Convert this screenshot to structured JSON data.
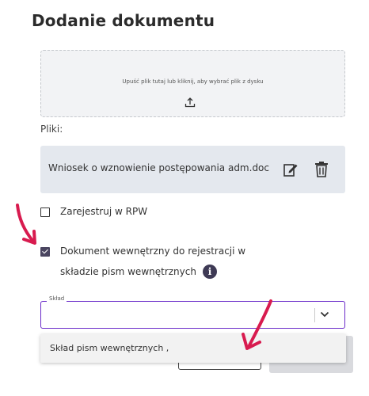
{
  "dialog": {
    "title": "Dodanie dokumentu"
  },
  "upload": {
    "dropzone_text": "Upuść plik tutaj lub kliknij, aby wybrać plik z dysku",
    "icon": "upload-icon"
  },
  "files": {
    "label": "Pliki:",
    "items": [
      {
        "name": "Wniosek o wznowienie postępowania adm.doc"
      }
    ]
  },
  "options": {
    "register_rpw": {
      "label": "Zarejestruj w RPW",
      "checked": false
    },
    "internal_doc": {
      "label_line1": "Dokument wewnętrzny do rejestracji w",
      "label_line2": "składzie pism wewnętrznych",
      "checked": true
    }
  },
  "sklad_select": {
    "label": "Skład",
    "value": "",
    "options": [
      "Skład pism wewnętrznych ,"
    ]
  },
  "colors": {
    "accent": "#6a2bc9",
    "annotation": "#d81b4f",
    "file_bg": "#e4e8ee"
  }
}
